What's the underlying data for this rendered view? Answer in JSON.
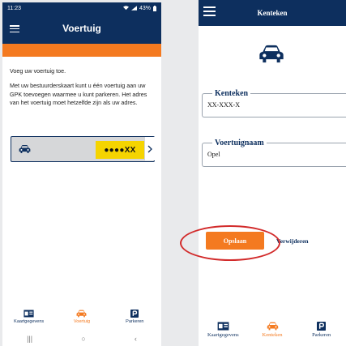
{
  "colors": {
    "navy": "#0d2f5e",
    "orange": "#f47a20",
    "plate_yellow": "#f5d400",
    "annotation_red": "#d22a2a"
  },
  "left": {
    "status": {
      "time": "11:23",
      "battery": "43%"
    },
    "header": {
      "title": "Voertuig",
      "menu_icon": "hamburger-icon"
    },
    "intro": "Voeg uw voertuig toe.",
    "description": "Met uw bestuurderskaart kunt u één voertuig aan uw GPK toevoegen waarmee u kunt parkeren. Het adres van het voertuig moet hetzelfde zijn als uw adres.",
    "vehicle": {
      "plate": "●●●●XX",
      "icon": "car-icon"
    },
    "tabs": [
      {
        "label": "Kaartgegevens",
        "icon": "id-card-icon",
        "active": false
      },
      {
        "label": "Voertuig",
        "icon": "car-icon",
        "active": true
      },
      {
        "label": "Parkeren",
        "icon": "parking-icon",
        "active": false
      }
    ]
  },
  "right": {
    "header": {
      "title": "Kenteken",
      "menu_icon": "hamburger-icon"
    },
    "fields": [
      {
        "legend": "Kenteken",
        "value": "XX-XXX-X"
      },
      {
        "legend": "Voertuignaam",
        "value": "Opel"
      }
    ],
    "save_label": "Opslaan",
    "delete_label": "Verwijderen",
    "tabs": [
      {
        "label": "Kaartgegevens",
        "icon": "id-card-icon",
        "active": false
      },
      {
        "label": "Kenteken",
        "icon": "car-icon",
        "active": true
      },
      {
        "label": "Parkeren",
        "icon": "parking-icon",
        "active": false
      }
    ]
  }
}
